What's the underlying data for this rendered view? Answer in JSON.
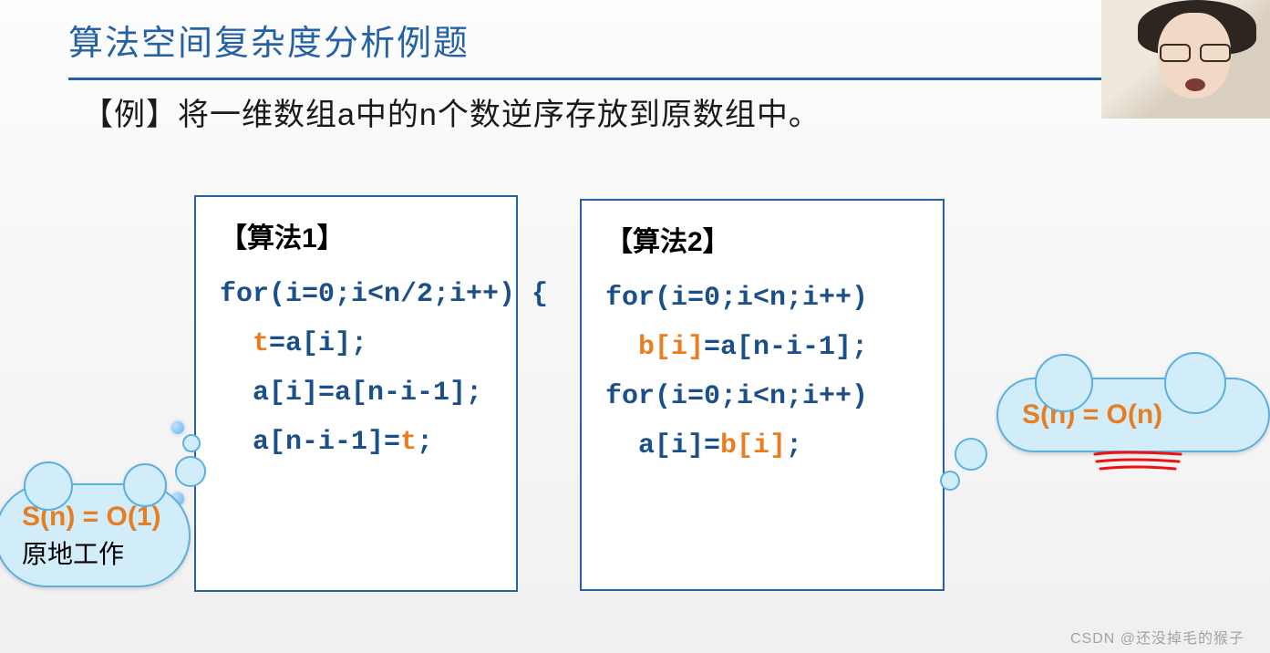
{
  "title": "算法空间复杂度分析例题",
  "example": "【例】将一维数组a中的n个数逆序存放到原数组中。",
  "algo1": {
    "header": "【算法1】",
    "line1_pre": "for(i=0;i<n/2;i++) {",
    "line2_t": "t",
    "line2_rest": "=a[i];",
    "line3": "a[i]=a[n-i-1];",
    "line4_pre": "a[n-i-1]=",
    "line4_t": "t",
    "line4_post": ";"
  },
  "algo2": {
    "header": "【算法2】",
    "line1": "for(i=0;i<n;i++)",
    "line2_b": "b[i]",
    "line2_rest": "=a[n-i-1];",
    "line3": "for(i=0;i<n;i++)",
    "line4_pre": "a[i]=",
    "line4_b": "b[i]",
    "line4_post": ";"
  },
  "cloud_left": {
    "formula": "S(n) = O(1)",
    "note": "原地工作"
  },
  "cloud_right": {
    "formula": "S(n) = O(n)"
  },
  "watermark": "CSDN @还没掉毛的猴子"
}
